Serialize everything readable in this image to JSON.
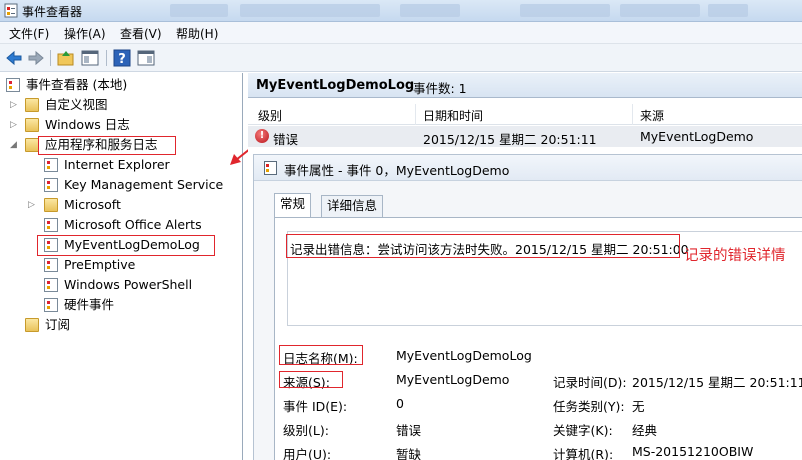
{
  "window": {
    "title": "事件查看器"
  },
  "menu": {
    "items": [
      "文件(F)",
      "操作(A)",
      "查看(V)",
      "帮助(H)"
    ]
  },
  "toolbar": {
    "icons": [
      "back-icon",
      "forward-icon",
      "up-folder-icon",
      "show-hide-tree-icon",
      "help-icon",
      "show-hide-action-pane-icon"
    ]
  },
  "tree": {
    "root": "事件查看器 (本地)",
    "items": [
      {
        "label": "自定义视图",
        "level": 1,
        "icon": "folder-icon",
        "expander": "collapsed"
      },
      {
        "label": "Windows 日志",
        "level": 1,
        "icon": "folder-icon",
        "expander": "collapsed"
      },
      {
        "label": "应用程序和服务日志",
        "level": 1,
        "icon": "folder-icon",
        "expander": "expanded"
      },
      {
        "label": "Internet Explorer",
        "level": 2,
        "icon": "log-icon",
        "expander": "none"
      },
      {
        "label": "Key Management Service",
        "level": 2,
        "icon": "log-icon",
        "expander": "none"
      },
      {
        "label": "Microsoft",
        "level": 2,
        "icon": "folder-icon",
        "expander": "collapsed"
      },
      {
        "label": "Microsoft Office Alerts",
        "level": 2,
        "icon": "log-icon",
        "expander": "none"
      },
      {
        "label": "MyEventLogDemoLog",
        "level": 2,
        "icon": "log-icon",
        "expander": "none"
      },
      {
        "label": "PreEmptive",
        "level": 2,
        "icon": "log-icon",
        "expander": "none"
      },
      {
        "label": "Windows PowerShell",
        "level": 2,
        "icon": "log-icon",
        "expander": "none"
      },
      {
        "label": "硬件事件",
        "level": 2,
        "icon": "log-icon",
        "expander": "none"
      },
      {
        "label": "订阅",
        "level": 1,
        "icon": "subscription-icon",
        "expander": "none"
      }
    ]
  },
  "log_pane": {
    "name": "MyEventLogDemoLog",
    "count": "事件数: 1",
    "columns": [
      "级别",
      "日期和时间",
      "来源"
    ],
    "rows": [
      {
        "level": "错误",
        "datetime": "2015/12/15 星期二 20:51:11",
        "source": "MyEventLogDemo"
      }
    ]
  },
  "properties": {
    "title": "事件属性 - 事件 0，MyEventLogDemo",
    "tabs": [
      "常规",
      "详细信息"
    ],
    "description": "记录出错信息：尝试访问该方法时失败。2015/12/15 星期二 20:51:00",
    "annotation": "记录的错误详情",
    "fields": {
      "log_name_label": "日志名称(M):",
      "log_name_value": "MyEventLogDemoLog",
      "source_label": "来源(S):",
      "source_value": "MyEventLogDemo",
      "logged_label": "记录时间(D):",
      "logged_value": "2015/12/15 星期二 20:51:11",
      "event_id_label": "事件 ID(E):",
      "event_id_value": "0",
      "task_label": "任务类别(Y):",
      "task_value": "无",
      "level_label": "级别(L):",
      "level_value": "错误",
      "keywords_label": "关键字(K):",
      "keywords_value": "经典",
      "user_label": "用户(U):",
      "user_value": "暂缺",
      "computer_label": "计算机(R):",
      "computer_value": "MS-20151210OBIW"
    }
  },
  "colors": {
    "highlight_box": "#e0262d",
    "selected_row": "#e9ecf1",
    "error_icon": "#b8141b"
  }
}
